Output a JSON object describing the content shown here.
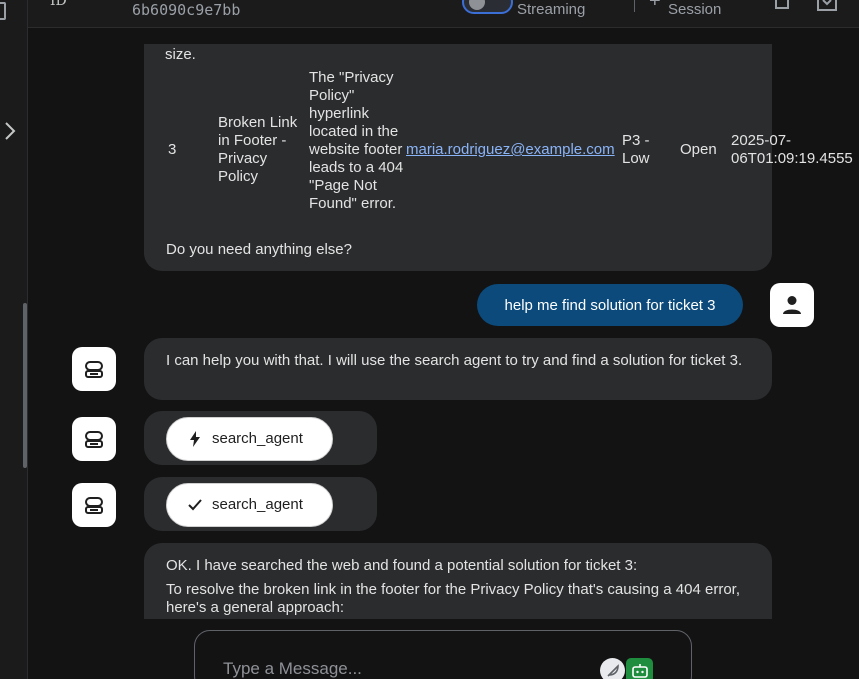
{
  "header": {
    "id_label": "ID",
    "session_id": "6b6090c9e7bb",
    "streaming_label": "Streaming",
    "new_session_label": "Session",
    "streaming_enabled": false
  },
  "ticket_table": {
    "overflow_text": "size.",
    "row": {
      "id": "3",
      "title": "Broken Link in Footer - Privacy Policy",
      "description": "The \"Privacy Policy\" hyperlink located in the website footer leads to a 404 \"Page Not Found\" error.",
      "email": "maria.rodriguez@example.com",
      "priority": "P3 - Low",
      "status": "Open",
      "created": "2025-07-\n06T01:09:19.4555"
    },
    "closing": "Do you need anything else?"
  },
  "messages": {
    "user_1": "help me find solution for ticket 3",
    "agent_1": "I can help you with that. I will use the search agent to try and find a solution for ticket 3.",
    "tool_call": "search_agent",
    "tool_result": "search_agent",
    "agent_2_p1": "OK. I have searched the web and found a potential solution for ticket 3:",
    "agent_2_p2": "To resolve the broken link in the footer for the Privacy Policy that's causing a 404 error, here's a general approach:"
  },
  "composer": {
    "placeholder": "Type a Message..."
  },
  "icons": {
    "rail_top": "panel-icon",
    "rail_toggle": "chevron-right-icon",
    "new_session": "plus-icon",
    "delete": "trash-icon",
    "download": "download-icon",
    "user": "person-icon",
    "bot": "robot-icon",
    "tool_call": "bolt-icon",
    "tool_done": "check-icon",
    "composer_a": "feather-icon",
    "composer_b": "robot-icon"
  },
  "colors": {
    "user_bubble": "#0b4a7a",
    "link": "#8ab4f8",
    "toggle_border": "#3b6fd6",
    "agent_icon_bg": "#1e8e3e"
  }
}
